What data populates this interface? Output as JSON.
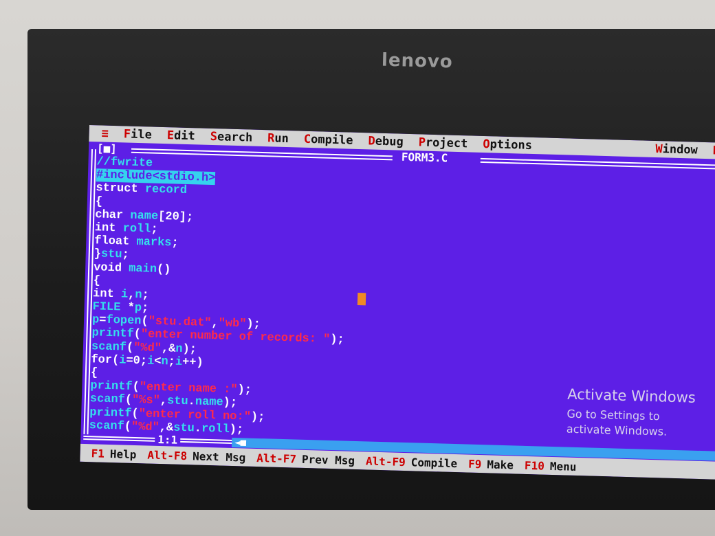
{
  "monitor": {
    "brand": "lenovo"
  },
  "menu": {
    "system_glyph": "≡",
    "items": [
      {
        "hot": "F",
        "rest": "ile"
      },
      {
        "hot": "E",
        "rest": "dit"
      },
      {
        "hot": "S",
        "rest": "earch"
      },
      {
        "hot": "R",
        "rest": "un"
      },
      {
        "hot": "C",
        "rest": "ompile"
      },
      {
        "hot": "D",
        "rest": "ebug"
      },
      {
        "hot": "P",
        "rest": "roject"
      },
      {
        "hot": "O",
        "rest": "ptions"
      },
      {
        "hot": "W",
        "rest": "indow"
      },
      {
        "hot": "H",
        "rest": "e"
      }
    ]
  },
  "editor": {
    "filename": "FORM3.C",
    "close_box": "[■]",
    "cursor_position": "1:1",
    "code_lines": [
      [
        {
          "t": "//fwrite",
          "c": "#35e0ec"
        }
      ],
      [
        {
          "t": "#include<stdio.h>",
          "c": "#5d1fe6",
          "bg": "#35d2ee"
        }
      ],
      [
        {
          "t": "struct ",
          "c": "#ffffff"
        },
        {
          "t": "record",
          "c": "#35e0ec"
        }
      ],
      [
        {
          "t": "{",
          "c": "#ffffff"
        }
      ],
      [
        {
          "t": "char ",
          "c": "#ffffff"
        },
        {
          "t": "name",
          "c": "#35e0ec"
        },
        {
          "t": "[20];",
          "c": "#ffffff"
        }
      ],
      [
        {
          "t": "int ",
          "c": "#ffffff"
        },
        {
          "t": "roll",
          "c": "#35e0ec"
        },
        {
          "t": ";",
          "c": "#ffffff"
        }
      ],
      [
        {
          "t": "float ",
          "c": "#ffffff"
        },
        {
          "t": "marks",
          "c": "#35e0ec"
        },
        {
          "t": ";",
          "c": "#ffffff"
        }
      ],
      [
        {
          "t": "}",
          "c": "#ffffff"
        },
        {
          "t": "stu",
          "c": "#35e0ec"
        },
        {
          "t": ";",
          "c": "#ffffff"
        }
      ],
      [
        {
          "t": "void ",
          "c": "#ffffff"
        },
        {
          "t": "main",
          "c": "#35e0ec"
        },
        {
          "t": "()",
          "c": "#ffffff"
        }
      ],
      [
        {
          "t": "{",
          "c": "#ffffff"
        }
      ],
      [
        {
          "t": "int ",
          "c": "#ffffff"
        },
        {
          "t": "i",
          "c": "#35e0ec"
        },
        {
          "t": ",",
          "c": "#ffffff"
        },
        {
          "t": "n",
          "c": "#35e0ec"
        },
        {
          "t": ";",
          "c": "#ffffff"
        }
      ],
      [
        {
          "t": "FILE ",
          "c": "#35e0ec"
        },
        {
          "t": "*",
          "c": "#ffffff"
        },
        {
          "t": "p",
          "c": "#35e0ec"
        },
        {
          "t": ";",
          "c": "#ffffff"
        }
      ],
      [
        {
          "t": "p",
          "c": "#35e0ec"
        },
        {
          "t": "=",
          "c": "#ffffff"
        },
        {
          "t": "fopen",
          "c": "#35e0ec"
        },
        {
          "t": "(",
          "c": "#ffffff"
        },
        {
          "t": "\"stu.dat\"",
          "c": "#ff2a4a"
        },
        {
          "t": ",",
          "c": "#ffffff"
        },
        {
          "t": "\"wb\"",
          "c": "#ff2a4a"
        },
        {
          "t": ");",
          "c": "#ffffff"
        }
      ],
      [
        {
          "t": "printf",
          "c": "#35e0ec"
        },
        {
          "t": "(",
          "c": "#ffffff"
        },
        {
          "t": "\"enter number of records: \"",
          "c": "#ff2a4a"
        },
        {
          "t": ");",
          "c": "#ffffff"
        }
      ],
      [
        {
          "t": "scanf",
          "c": "#35e0ec"
        },
        {
          "t": "(",
          "c": "#ffffff"
        },
        {
          "t": "\"%d\"",
          "c": "#ff2a4a"
        },
        {
          "t": ",&",
          "c": "#ffffff"
        },
        {
          "t": "n",
          "c": "#35e0ec"
        },
        {
          "t": ");",
          "c": "#ffffff"
        }
      ],
      [
        {
          "t": "for",
          "c": "#ffffff"
        },
        {
          "t": "(",
          "c": "#ffffff"
        },
        {
          "t": "i",
          "c": "#35e0ec"
        },
        {
          "t": "=0;",
          "c": "#ffffff"
        },
        {
          "t": "i",
          "c": "#35e0ec"
        },
        {
          "t": "<",
          "c": "#ffffff"
        },
        {
          "t": "n",
          "c": "#35e0ec"
        },
        {
          "t": ";",
          "c": "#ffffff"
        },
        {
          "t": "i",
          "c": "#35e0ec"
        },
        {
          "t": "++)",
          "c": "#ffffff"
        }
      ],
      [
        {
          "t": "{",
          "c": "#ffffff"
        }
      ],
      [
        {
          "t": "printf",
          "c": "#35e0ec"
        },
        {
          "t": "(",
          "c": "#ffffff"
        },
        {
          "t": "\"enter name :\"",
          "c": "#ff2a4a"
        },
        {
          "t": ");",
          "c": "#ffffff"
        }
      ],
      [
        {
          "t": "scanf",
          "c": "#35e0ec"
        },
        {
          "t": "(",
          "c": "#ffffff"
        },
        {
          "t": "\"%s\"",
          "c": "#ff2a4a"
        },
        {
          "t": ",",
          "c": "#ffffff"
        },
        {
          "t": "stu",
          "c": "#35e0ec"
        },
        {
          "t": ".",
          "c": "#ffffff"
        },
        {
          "t": "name",
          "c": "#35e0ec"
        },
        {
          "t": ");",
          "c": "#ffffff"
        }
      ],
      [
        {
          "t": "printf",
          "c": "#35e0ec"
        },
        {
          "t": "(",
          "c": "#ffffff"
        },
        {
          "t": "\"enter roll no:\"",
          "c": "#ff2a4a"
        },
        {
          "t": ");",
          "c": "#ffffff"
        }
      ],
      [
        {
          "t": "scanf",
          "c": "#35e0ec"
        },
        {
          "t": "(",
          "c": "#ffffff"
        },
        {
          "t": "\"%d\"",
          "c": "#ff2a4a"
        },
        {
          "t": ",&",
          "c": "#ffffff"
        },
        {
          "t": "stu",
          "c": "#35e0ec"
        },
        {
          "t": ".",
          "c": "#ffffff"
        },
        {
          "t": "roll",
          "c": "#35e0ec"
        },
        {
          "t": ");",
          "c": "#ffffff"
        }
      ]
    ]
  },
  "status_bar": {
    "items": [
      {
        "key": "F1",
        "label": "Help"
      },
      {
        "key": "Alt-F8",
        "label": "Next Msg"
      },
      {
        "key": "Alt-F7",
        "label": "Prev Msg"
      },
      {
        "key": "Alt-F9",
        "label": "Compile"
      },
      {
        "key": "F9",
        "label": "Make"
      },
      {
        "key": "F10",
        "label": "Menu"
      }
    ]
  },
  "watermark": {
    "title": "Activate Windows",
    "line1": "Go to Settings to",
    "line2": "activate Windows."
  },
  "colors": {
    "editor_bg": "#5d1fe6",
    "menu_bg": "#d4d4d4",
    "hotkey": "#cc0000",
    "identifier": "#35e0ec",
    "string_literal": "#ff2a4a",
    "cursor": "#f08a24"
  }
}
